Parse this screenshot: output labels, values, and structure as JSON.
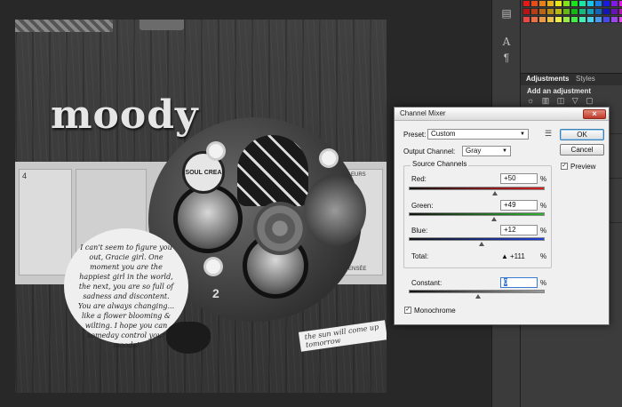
{
  "canvas": {
    "title_word": "moody",
    "stamp_text": "SOUL CREA",
    "quote": "I can't seem to figure you out, Gracie girl. One moment you are the happiest girl in the world, the next, you are so full of sadness and discontent. You are always changing... like a flower blooming & wilting. I hope you can someday control your moods!",
    "tagline": "the sun will come up tomorrow",
    "flower_label": "FLEURS",
    "pensee_label": "PENSÉE",
    "number_4": "4",
    "number_2": "2"
  },
  "panels": {
    "tab_adjustments": "Adjustments",
    "tab_styles": "Styles",
    "add_adjustment": "Add an adjustment",
    "adj_icons": "☼ ▥ ◫ ▽ ▢"
  },
  "dialog": {
    "title": "Channel Mixer",
    "close_label": "×",
    "preset_label": "Preset:",
    "preset_value": "Custom",
    "output_label": "Output Channel:",
    "output_value": "Gray",
    "source_title": "Source Channels",
    "red_label": "Red:",
    "red_value": "+50",
    "green_label": "Green:",
    "green_value": "+49",
    "blue_label": "Blue:",
    "blue_value": "+12",
    "total_label": "Total:",
    "total_value": "+111",
    "warn_icon": "▲",
    "constant_label": "Constant:",
    "constant_value": "0",
    "pct": "%",
    "ok": "OK",
    "cancel": "Cancel",
    "preview": "Preview",
    "monochrome": "Monochrome",
    "check_mark": "✓"
  },
  "colors": {
    "red_slider": "#d41f1f",
    "green_slider": "#2faf2f",
    "blue_slider": "#1f3fd4",
    "constant_slider": "#9a9a9a",
    "accent": "#3a7bd5"
  },
  "sliders": {
    "red_percent": 50,
    "green_percent": 49,
    "blue_percent": 12,
    "constant_percent": 0
  }
}
